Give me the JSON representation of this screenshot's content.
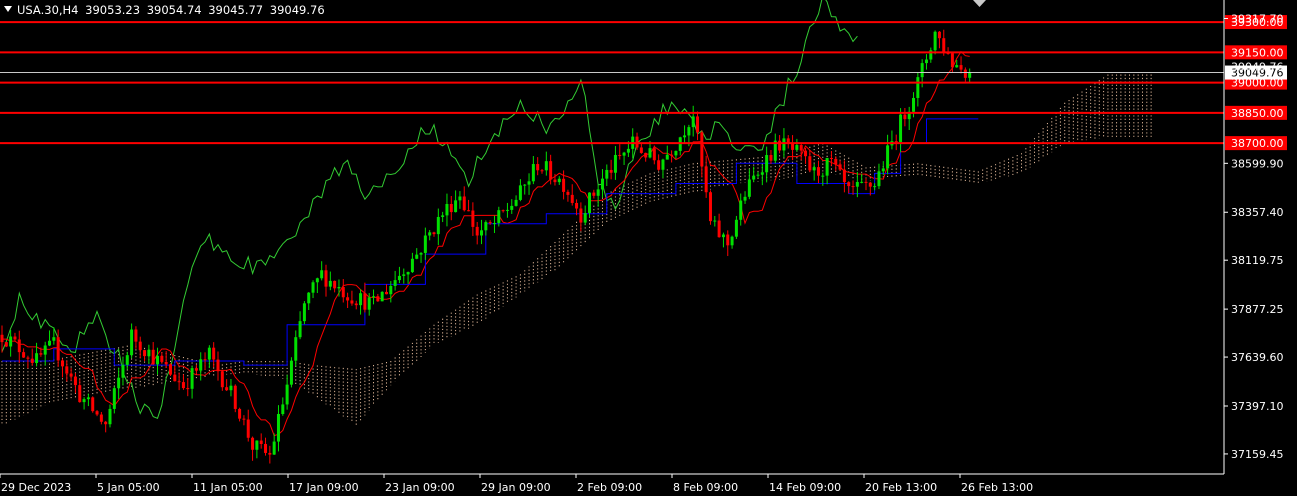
{
  "header": {
    "symbol": "USA.30,H4",
    "ohlc": [
      "39053.23",
      "39054.74",
      "39045.77",
      "39049.76"
    ]
  },
  "colors": {
    "background": "#000000",
    "axis": "#ffffff",
    "bull": "#00e000",
    "bear": "#ff0000",
    "chikou": "#33cc33",
    "tenkan": "#ff0000",
    "kijun": "#0000ff",
    "cloud": "#f5c9a8",
    "level_line": "#ff0000",
    "level_label_bg": "#ff0000",
    "current_price_bg": "#ffffff"
  },
  "chart_data": {
    "type": "candlestick",
    "indicator": "Ichimoku",
    "ylim": [
      37060,
      39340
    ],
    "y_ticks": [
      "39317.70",
      "38599.90",
      "38357.40",
      "38119.75",
      "37877.25",
      "37639.60",
      "37397.10",
      "37159.45"
    ],
    "x_ticks": [
      "29 Dec 2023",
      "5 Jan 05:00",
      "11 Jan 05:00",
      "17 Jan 09:00",
      "23 Jan 09:00",
      "29 Jan 09:00",
      "2 Feb 09:00",
      "8 Feb 09:00",
      "14 Feb 09:00",
      "20 Feb 13:00",
      "26 Feb 13:00"
    ],
    "hidden_tick_labels": [
      "39049.76"
    ],
    "current_price": {
      "value": 39049.76,
      "label": "39049.76"
    },
    "levels": [
      {
        "value": 39300,
        "label": "39300.00"
      },
      {
        "value": 39150,
        "label": "39150.00"
      },
      {
        "value": 39000,
        "label": "39000.00"
      },
      {
        "value": 38850,
        "label": "38850.00"
      },
      {
        "value": 38700,
        "label": "38700.00"
      }
    ],
    "price_waypoints": [
      [
        0,
        37750
      ],
      [
        8,
        37620
      ],
      [
        12,
        37700
      ],
      [
        18,
        37450
      ],
      [
        24,
        37300
      ],
      [
        30,
        37750
      ],
      [
        36,
        37620
      ],
      [
        42,
        37500
      ],
      [
        48,
        37650
      ],
      [
        54,
        37420
      ],
      [
        58,
        37200
      ],
      [
        62,
        37150
      ],
      [
        66,
        37500
      ],
      [
        70,
        37900
      ],
      [
        74,
        38050
      ],
      [
        80,
        37950
      ],
      [
        86,
        37900
      ],
      [
        90,
        38000
      ],
      [
        96,
        38150
      ],
      [
        102,
        38350
      ],
      [
        106,
        38450
      ],
      [
        110,
        38250
      ],
      [
        114,
        38300
      ],
      [
        120,
        38450
      ],
      [
        124,
        38600
      ],
      [
        130,
        38500
      ],
      [
        134,
        38350
      ],
      [
        140,
        38550
      ],
      [
        146,
        38700
      ],
      [
        152,
        38600
      ],
      [
        156,
        38700
      ],
      [
        160,
        38850
      ],
      [
        164,
        38300
      ],
      [
        168,
        38200
      ],
      [
        172,
        38450
      ],
      [
        176,
        38600
      ],
      [
        180,
        38700
      ],
      [
        184,
        38650
      ],
      [
        188,
        38550
      ],
      [
        192,
        38600
      ],
      [
        196,
        38450
      ],
      [
        202,
        38500
      ],
      [
        208,
        38800
      ],
      [
        212,
        39000
      ],
      [
        216,
        39250
      ],
      [
        220,
        39100
      ],
      [
        224,
        39049.76
      ]
    ],
    "cloud_waypoints": [
      [
        0,
        37300,
        37620
      ],
      [
        10,
        37400,
        37620
      ],
      [
        20,
        37450,
        37660
      ],
      [
        30,
        37480,
        37700
      ],
      [
        40,
        37520,
        37650
      ],
      [
        50,
        37550,
        37600
      ],
      [
        56,
        37560,
        37620
      ],
      [
        66,
        37530,
        37620
      ],
      [
        72,
        37450,
        37600
      ],
      [
        82,
        37300,
        37580
      ],
      [
        90,
        37500,
        37620
      ],
      [
        100,
        37700,
        37800
      ],
      [
        110,
        37800,
        37950
      ],
      [
        120,
        37950,
        38050
      ],
      [
        130,
        38100,
        38250
      ],
      [
        140,
        38300,
        38450
      ],
      [
        150,
        38400,
        38550
      ],
      [
        160,
        38450,
        38600
      ],
      [
        170,
        38500,
        38620
      ],
      [
        180,
        38520,
        38640
      ],
      [
        190,
        38560,
        38700
      ],
      [
        200,
        38510,
        38580
      ],
      [
        212,
        38540,
        38600
      ],
      [
        226,
        38500,
        38560
      ],
      [
        236,
        38550,
        38650
      ],
      [
        246,
        38700,
        38900
      ],
      [
        256,
        38730,
        39040
      ],
      [
        266,
        38730,
        39040
      ]
    ],
    "kijun_levels": [
      [
        0,
        37620
      ],
      [
        12,
        37680
      ],
      [
        26,
        37600
      ],
      [
        40,
        37620
      ],
      [
        56,
        37600
      ],
      [
        66,
        37800
      ],
      [
        84,
        38000
      ],
      [
        98,
        38150
      ],
      [
        112,
        38300
      ],
      [
        126,
        38350
      ],
      [
        140,
        38450
      ],
      [
        156,
        38500
      ],
      [
        170,
        38600
      ],
      [
        184,
        38500
      ],
      [
        196,
        38450
      ],
      [
        202,
        38550
      ],
      [
        208,
        38700
      ],
      [
        214,
        38820
      ],
      [
        226,
        38820
      ]
    ]
  }
}
